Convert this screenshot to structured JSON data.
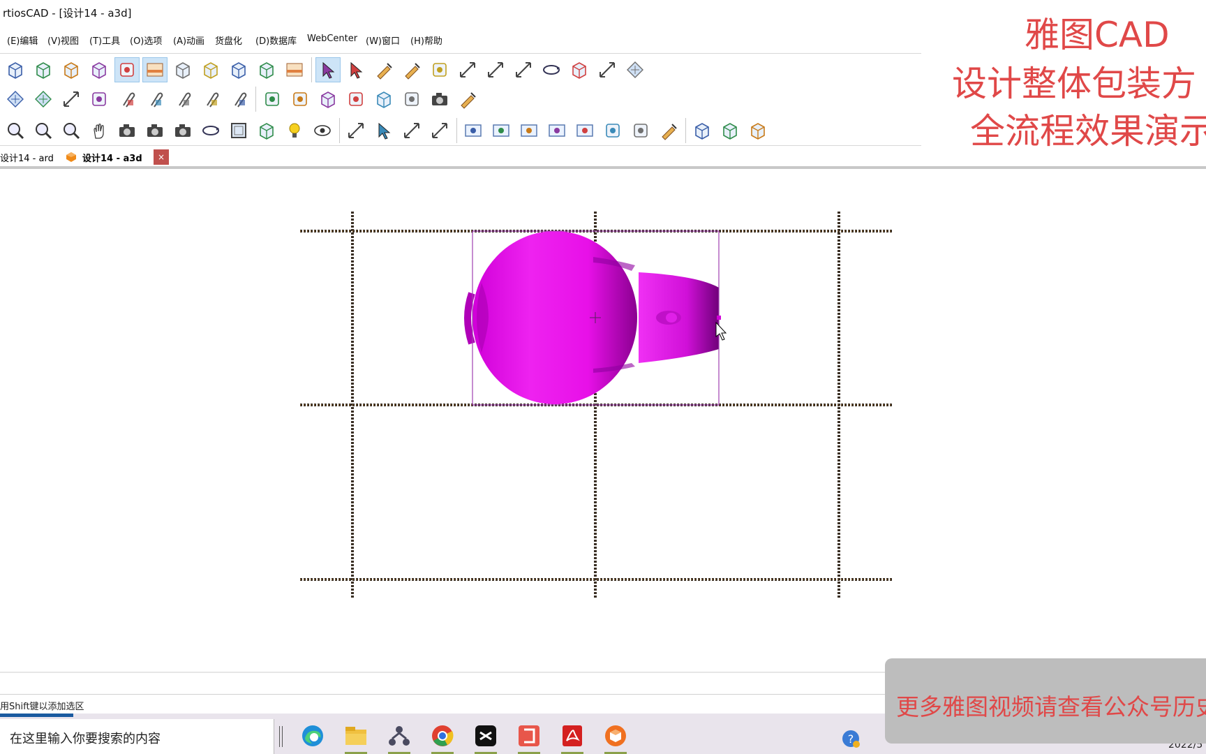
{
  "window": {
    "title": "rtiosCAD - [设计14 - a3d]"
  },
  "menu": [
    "(E)编辑",
    "(V)视图",
    "(T)工具",
    "(O)选项",
    "(A)动画",
    "货盘化",
    "(D)数据库",
    "WebCenter",
    "(W)窗口",
    "(H)帮助"
  ],
  "toolbar_row1": [
    "box-front-icon",
    "box-open-icon",
    "box-wire-icon",
    "box-fold-icon",
    "panel-fold-icon",
    "sunset-scene-icon",
    "box-blue-icon",
    "box-red-icon",
    "box-red-wire-icon",
    "cube-dark-icon",
    "stack-scene-icon",
    "select-arrow-icon",
    "select-green-icon",
    "measure-pencil-icon",
    "push-pin-icon",
    "line-edit-icon",
    "move-copy-icon",
    "move-copy2-icon",
    "scale-icon",
    "rotate-icon",
    "box-stack-icon",
    "move-cross-icon",
    "grid-layout-icon"
  ],
  "toolbar_row2": [
    "layout-red-icon",
    "layout-blue-icon",
    "dimension-icon",
    "diamond-icon",
    "clip-icon",
    "clip-edit-icon",
    "clip-orange-icon",
    "clip-cut-icon",
    "clip-delete-icon",
    "pallet-icon",
    "bottles-icon",
    "ball-box-icon",
    "printer-icon",
    "box-red-dotted-icon",
    "truck-icon",
    "camera-small-icon",
    "pin-add-icon"
  ],
  "toolbar_row3": [
    "zoom-out-icon",
    "zoom-in-icon",
    "zoom-fit-icon",
    "hand-pan-icon",
    "camera-icon",
    "camera-prev-icon",
    "camera-next-icon",
    "orbit-icon",
    "frame-icon",
    "box-3d-icon",
    "light-bulb-icon",
    "eye-icon",
    "dim-line-icon",
    "dim-arrow-icon",
    "move-3d-icon",
    "move-3d2-icon",
    "film-add-icon",
    "film-sync-icon",
    "film-sync2-icon",
    "film-play-icon",
    "film-delete-icon",
    "shuffle-icon",
    "wave-icon",
    "ruler-icon",
    "cube-wire-icon",
    "cube-wire2-icon",
    "cube-delete-icon"
  ],
  "tabs": [
    {
      "label": "设计14 - ard"
    },
    {
      "label": "设计14 - a3d"
    }
  ],
  "tab_close": "×",
  "status": {
    "hint": "用Shift键以添加选区"
  },
  "taskbar": {
    "search_placeholder": "在这里输入你要搜索的内容",
    "apps": [
      "edge-icon",
      "folder-icon",
      "network-icon",
      "chrome-icon",
      "capcut-icon",
      "red-app-icon",
      "pdf-icon",
      "artios-icon"
    ],
    "date": "2022/5"
  },
  "overlay": {
    "line1": "雅图CAD",
    "line2": "设计整体包装方",
    "line3": "全流程效果演示",
    "bottom": "更多雅图视频请查看公众号历史"
  },
  "colors": {
    "accent_red": "#e04848",
    "object_magenta": "#e010e0",
    "grid_dash": "#3a2f24"
  }
}
